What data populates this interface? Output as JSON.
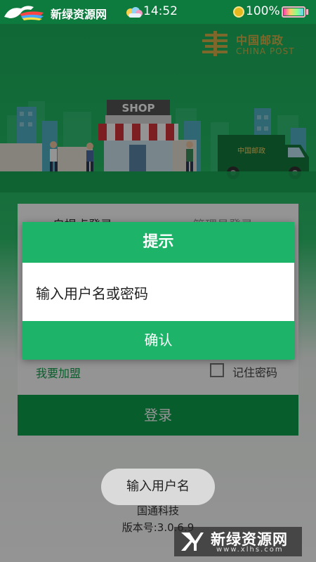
{
  "status_bar": {
    "app_name": "新绿资源网",
    "time": "14:52",
    "battery": "100%",
    "battery_level": 1.0
  },
  "brand": {
    "chinese": "中国邮政",
    "english": "CHINA POST",
    "shop_sign": "SHOP",
    "truck_label": "中国邮政"
  },
  "login": {
    "tab_user": "自提点登录",
    "tab_admin": "管理员登录",
    "join_link": "我要加盟",
    "remember_label": "记住密码",
    "remember_checked": false,
    "login_button": "登录"
  },
  "dialog": {
    "title": "提示",
    "message": "输入用户名或密码",
    "confirm": "确认"
  },
  "toast": {
    "message": "输入用户名"
  },
  "footer": {
    "company": "国通科技",
    "version": "版本号:3.0.6.9"
  },
  "watermark": {
    "title": "新绿资源网",
    "url": "www.xlhs.com"
  },
  "colors": {
    "status_bar": "#0d7a3e",
    "primary_green": "#1db46a",
    "button_green": "#0fa14d",
    "post_gold": "#d8b24a"
  }
}
